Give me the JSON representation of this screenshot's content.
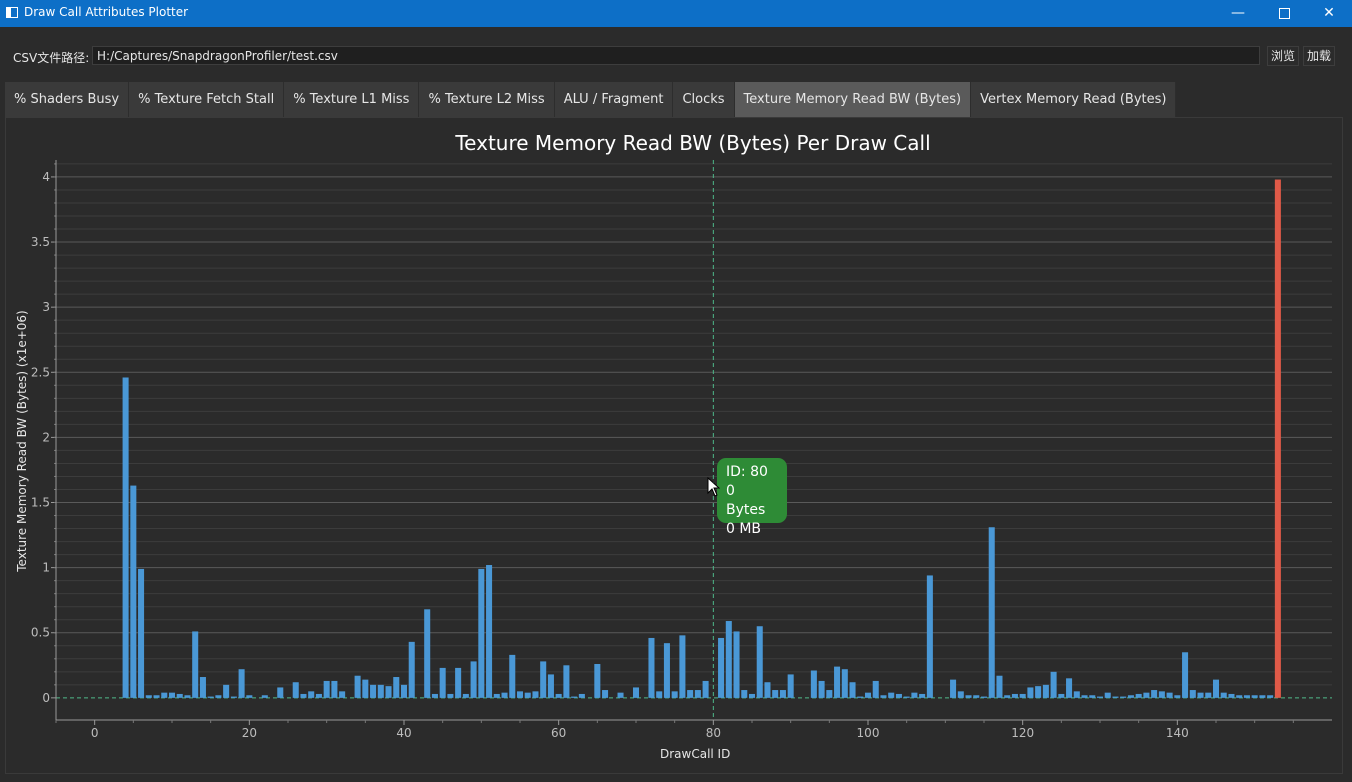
{
  "window": {
    "title": "Draw Call Attributes Plotter",
    "minimize_glyph": "—",
    "close_glyph": "✕"
  },
  "path_row": {
    "label": "CSV文件路径:",
    "value": "H:/Captures/SnapdragonProfiler/test.csv",
    "browse_label": "浏览",
    "load_label": "加载"
  },
  "tabs": [
    {
      "label": "% Shaders Busy",
      "active": false
    },
    {
      "label": "% Texture Fetch Stall",
      "active": false
    },
    {
      "label": "% Texture L1 Miss",
      "active": false
    },
    {
      "label": "% Texture L2 Miss",
      "active": false
    },
    {
      "label": "ALU / Fragment",
      "active": false
    },
    {
      "label": "Clocks",
      "active": false
    },
    {
      "label": "Texture Memory Read BW (Bytes)",
      "active": true
    },
    {
      "label": "Vertex Memory Read (Bytes)",
      "active": false
    }
  ],
  "tooltip": {
    "line1": "ID: 80",
    "line2": "0 Bytes",
    "line3": "0 MB"
  },
  "colors": {
    "bar": "#4a98d6",
    "highlight_bar": "#e05a48",
    "marker_line": "#4fb98a",
    "tooltip_bg": "#2e8b36",
    "accent": "#0d6fc7"
  },
  "icons": {
    "app": "app-window-icon",
    "minimize": "minimize-icon",
    "maximize": "maximize-icon",
    "close": "close-icon",
    "cursor": "mouse-pointer-icon"
  },
  "chart_data": {
    "type": "bar",
    "title": "Texture Memory Read BW (Bytes) Per Draw Call",
    "xlabel": "DrawCall ID",
    "ylabel": "Texture Memory Read BW (Bytes) (x1e+06)",
    "xlim": [
      -5,
      160
    ],
    "ylim": [
      -0.17,
      4.13
    ],
    "x_ticks": [
      0,
      20,
      40,
      60,
      80,
      100,
      120,
      140
    ],
    "x_tick_labels": [
      "0",
      "20",
      "40",
      "60",
      "80",
      "100",
      "120",
      "140"
    ],
    "y_ticks": [
      0,
      0.5,
      1,
      1.5,
      2,
      2.5,
      3,
      3.5,
      4
    ],
    "y_tick_labels": [
      "0",
      "0.5",
      "1",
      "1.5",
      "2",
      "2.5",
      "3",
      "3.5",
      "4"
    ],
    "grid": true,
    "marker_x": 80,
    "highlight_index": 153,
    "x": [
      0,
      1,
      2,
      3,
      4,
      5,
      6,
      7,
      8,
      9,
      10,
      11,
      12,
      13,
      14,
      15,
      16,
      17,
      18,
      19,
      20,
      21,
      22,
      23,
      24,
      25,
      26,
      27,
      28,
      29,
      30,
      31,
      32,
      33,
      34,
      35,
      36,
      37,
      38,
      39,
      40,
      41,
      42,
      43,
      44,
      45,
      46,
      47,
      48,
      49,
      50,
      51,
      52,
      53,
      54,
      55,
      56,
      57,
      58,
      59,
      60,
      61,
      62,
      63,
      64,
      65,
      66,
      67,
      68,
      69,
      70,
      71,
      72,
      73,
      74,
      75,
      76,
      77,
      78,
      79,
      80,
      81,
      82,
      83,
      84,
      85,
      86,
      87,
      88,
      89,
      90,
      91,
      92,
      93,
      94,
      95,
      96,
      97,
      98,
      99,
      100,
      101,
      102,
      103,
      104,
      105,
      106,
      107,
      108,
      109,
      110,
      111,
      112,
      113,
      114,
      115,
      116,
      117,
      118,
      119,
      120,
      121,
      122,
      123,
      124,
      125,
      126,
      127,
      128,
      129,
      130,
      131,
      132,
      133,
      134,
      135,
      136,
      137,
      138,
      139,
      140,
      141,
      142,
      143,
      144,
      145,
      146,
      147,
      148,
      149,
      150,
      151,
      152,
      153
    ],
    "values": [
      0,
      0,
      0,
      0,
      2.46,
      1.63,
      0.99,
      0.02,
      0.02,
      0.04,
      0.04,
      0.03,
      0.02,
      0.51,
      0.16,
      0.01,
      0.02,
      0.1,
      0.01,
      0.22,
      0.02,
      0,
      0.02,
      0,
      0.08,
      0,
      0.12,
      0.03,
      0.05,
      0.03,
      0.13,
      0.13,
      0.05,
      0,
      0.17,
      0.14,
      0.1,
      0.1,
      0.09,
      0.16,
      0.1,
      0.43,
      0,
      0.68,
      0.03,
      0.23,
      0.03,
      0.23,
      0.03,
      0.28,
      0.99,
      1.02,
      0.03,
      0.04,
      0.33,
      0.05,
      0.04,
      0.05,
      0.28,
      0.18,
      0.03,
      0.25,
      0.01,
      0.03,
      0,
      0.26,
      0.06,
      0,
      0.04,
      0,
      0.08,
      0,
      0.46,
      0.05,
      0.42,
      0.05,
      0.48,
      0.06,
      0.06,
      0.13,
      0,
      0.46,
      0.59,
      0.51,
      0.06,
      0.03,
      0.55,
      0.12,
      0.06,
      0.06,
      0.18,
      0,
      0,
      0.21,
      0.13,
      0.06,
      0.24,
      0.22,
      0.12,
      0.01,
      0.04,
      0.13,
      0.02,
      0.04,
      0.03,
      0.01,
      0.04,
      0.03,
      0.94,
      0,
      0,
      0.14,
      0.05,
      0.02,
      0.02,
      0.01,
      1.31,
      0.17,
      0.02,
      0.03,
      0.03,
      0.08,
      0.09,
      0.1,
      0.2,
      0.03,
      0.15,
      0.05,
      0.02,
      0.02,
      0.01,
      0.04,
      0.01,
      0.01,
      0.02,
      0.03,
      0.04,
      0.06,
      0.05,
      0.04,
      0.02,
      0.35,
      0.06,
      0.04,
      0.04,
      0.14,
      0.04,
      0.03,
      0.02,
      0.02,
      0.02,
      0.02,
      0.02,
      3.98
    ]
  }
}
